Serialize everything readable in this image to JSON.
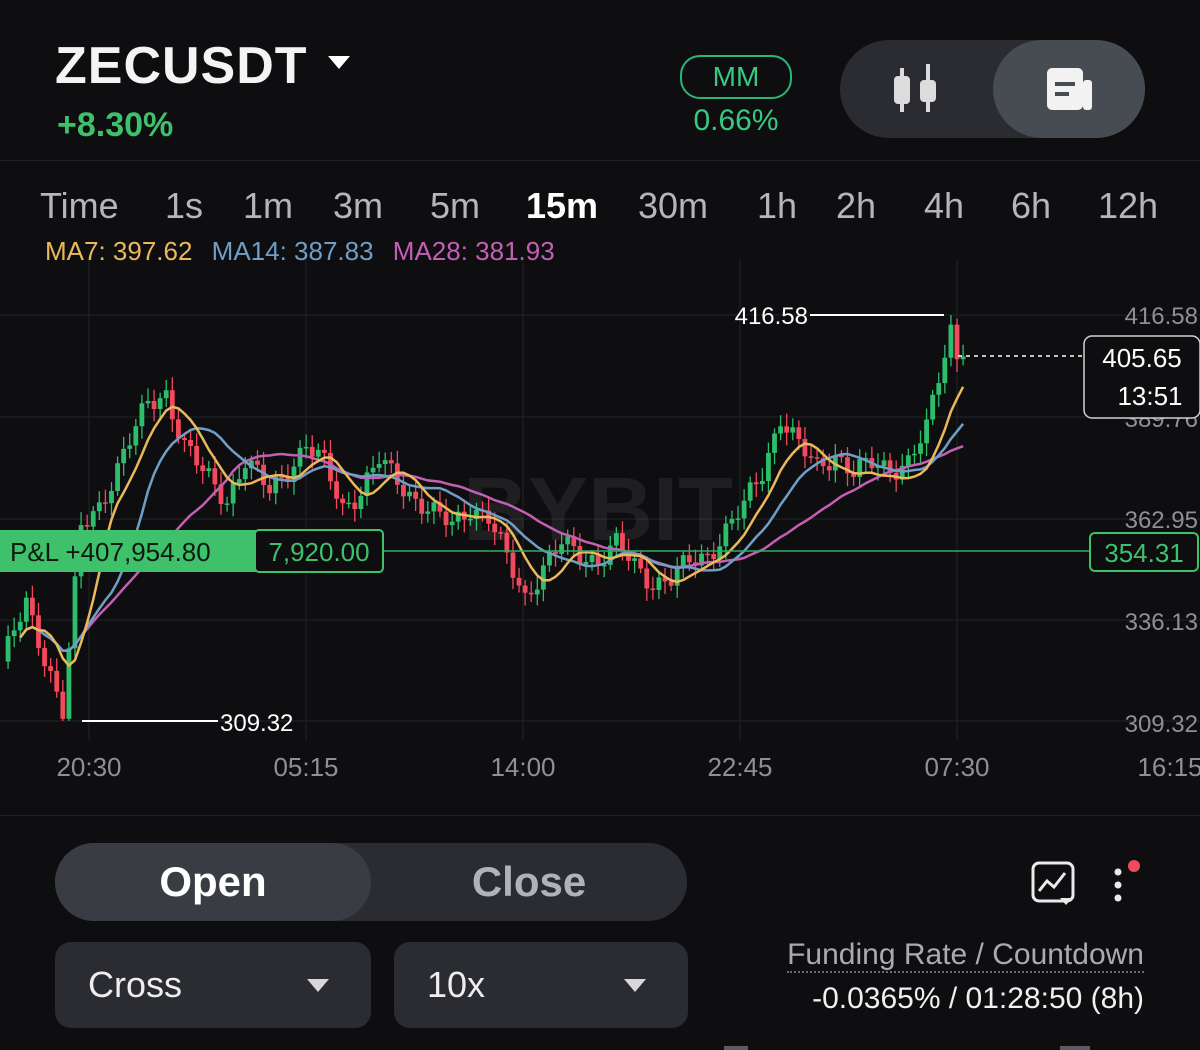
{
  "header": {
    "symbol": "ZECUSDT",
    "change": "+8.30%",
    "mm_label": "MM",
    "mm_value": "0.66%",
    "view_toggle": {
      "selected": "doc",
      "icons": [
        "candlestick-icon",
        "document-icon"
      ]
    }
  },
  "timeframes": {
    "items": [
      "Time",
      "1s",
      "1m",
      "3m",
      "5m",
      "15m",
      "30m",
      "1h",
      "2h",
      "4h",
      "6h",
      "12h"
    ],
    "active": "15m"
  },
  "ma_legend": {
    "ma7": "MA7: 397.62",
    "ma14": "MA14: 387.83",
    "ma28": "MA28: 381.93"
  },
  "colors": {
    "up": "#2ebd6b",
    "down": "#f04a5c",
    "ma7": "#e9b95c",
    "ma14": "#6f9fc7",
    "ma28": "#c45fb3",
    "accent_green": "#3fc06b"
  },
  "chart_data": {
    "type": "candlestick",
    "y_ticks": [
      "416.58",
      "389.76",
      "362.95",
      "336.13",
      "309.32"
    ],
    "x_ticks": [
      "20:30",
      "05:15",
      "14:00",
      "22:45",
      "07:30",
      "16:15"
    ],
    "ylim": [
      309.32,
      416.58
    ],
    "high_marker": "416.58",
    "low_marker": "309.32",
    "current_price": "405.65",
    "countdown": "13:51",
    "entry_price": "354.31",
    "pnl_label": "P&L +407,954.80",
    "pnl_qty": "7,920.00",
    "watermark": "BYBIT",
    "close_path": [
      [
        0,
        325
      ],
      [
        4,
        340
      ],
      [
        8,
        322
      ],
      [
        10,
        312
      ],
      [
        13,
        360
      ],
      [
        16,
        366
      ],
      [
        20,
        380
      ],
      [
        24,
        393
      ],
      [
        27,
        396
      ],
      [
        30,
        382
      ],
      [
        33,
        375
      ],
      [
        37,
        368
      ],
      [
        40,
        378
      ],
      [
        44,
        370
      ],
      [
        47,
        376
      ],
      [
        50,
        382
      ],
      [
        53,
        377
      ],
      [
        56,
        366
      ],
      [
        59,
        370
      ],
      [
        62,
        378
      ],
      [
        65,
        373
      ],
      [
        68,
        368
      ],
      [
        71,
        364
      ],
      [
        74,
        361
      ],
      [
        77,
        366
      ],
      [
        80,
        363
      ],
      [
        83,
        352
      ],
      [
        86,
        342
      ],
      [
        89,
        350
      ],
      [
        92,
        356
      ],
      [
        95,
        353
      ],
      [
        98,
        352
      ],
      [
        101,
        356
      ],
      [
        104,
        350
      ],
      [
        107,
        346
      ],
      [
        110,
        347
      ],
      [
        113,
        351
      ],
      [
        116,
        353
      ],
      [
        119,
        360
      ],
      [
        122,
        366
      ],
      [
        125,
        375
      ],
      [
        128,
        390
      ],
      [
        131,
        382
      ],
      [
        134,
        376
      ],
      [
        137,
        380
      ],
      [
        140,
        375
      ],
      [
        143,
        377
      ],
      [
        146,
        376
      ],
      [
        149,
        378
      ],
      [
        152,
        386
      ],
      [
        154,
        400
      ],
      [
        156,
        413
      ],
      [
        157,
        406
      ],
      [
        158,
        405.65
      ]
    ],
    "ma7_end": 397.62,
    "ma14_end": 387.83,
    "ma28_end": 381.93
  },
  "bottom": {
    "tab_open": "Open",
    "tab_close": "Close",
    "margin_mode": "Cross",
    "leverage": "10x",
    "funding_label": "Funding Rate / Countdown",
    "funding_value": "-0.0365% / 01:28:50 (8h)"
  }
}
